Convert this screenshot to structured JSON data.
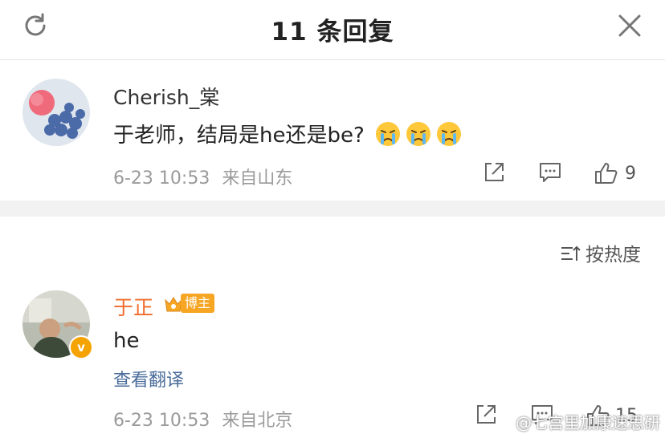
{
  "header": {
    "title": "11 条回复"
  },
  "comments": [
    {
      "username": "Cherish_棠",
      "text": "于老师，结局是he还是be?",
      "timestamp": "6-23 10:53",
      "location": "来自山东",
      "like_count": "9"
    },
    {
      "username": "于正",
      "badge": "博主",
      "text": "he",
      "translate_label": "查看翻译",
      "timestamp": "6-23 10:53",
      "location": "来自北京",
      "like_count": "15"
    }
  ],
  "sort": {
    "label": "按热度"
  },
  "watermark": "@七宫里加康速思研",
  "colors": {
    "accent": "#f06b2a",
    "muted": "#9a9a9a",
    "link": "#4a6c9a",
    "divider": "#f2f2f2"
  },
  "icons": [
    "refresh-icon",
    "close-icon",
    "share-icon",
    "comment-icon",
    "like-icon",
    "sort-icon",
    "crying-emoji"
  ]
}
